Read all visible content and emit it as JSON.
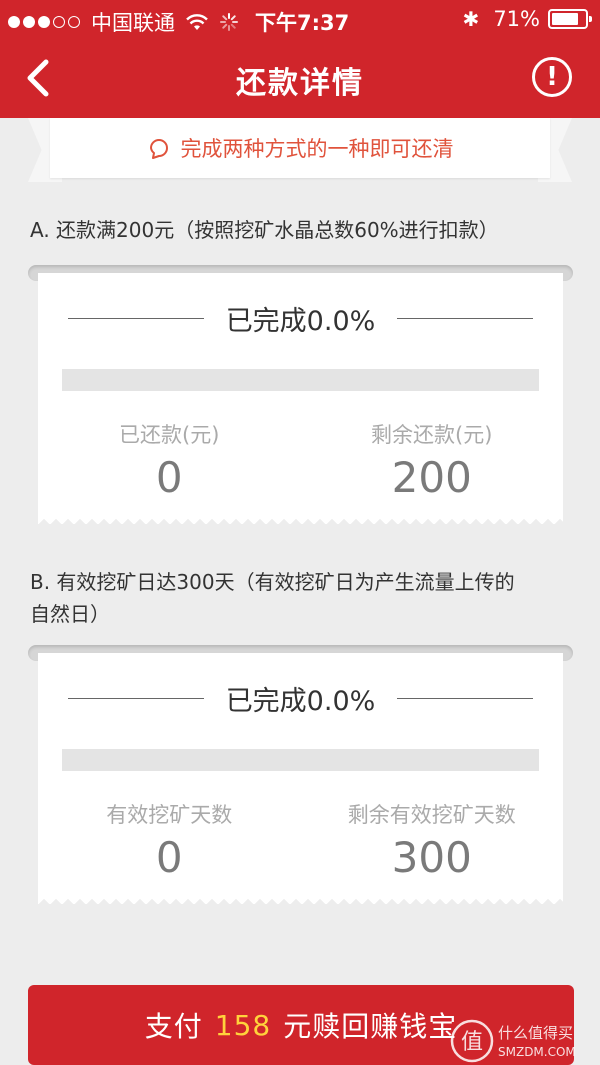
{
  "status_bar": {
    "signal_dots_filled": 3,
    "signal_dots_total": 5,
    "carrier": "中国联通",
    "time": "下午7:37",
    "battery_percent_label": "71%",
    "battery_level": 0.71
  },
  "nav": {
    "title": "还款详情",
    "back_icon": "chevron-left-icon",
    "info_icon": "exclamation-circle-icon",
    "info_glyph": "!"
  },
  "notice": {
    "icon": "bell-icon",
    "text": "完成两种方式的一种即可还清"
  },
  "option_a": {
    "title": "A. 还款满200元（按照挖矿水晶总数60%进行扣款）",
    "progress_label": "已完成0.0%",
    "progress_fraction": 0.0,
    "stat_left_label": "已还款(元)",
    "stat_left_value": "0",
    "stat_right_label": "剩余还款(元)",
    "stat_right_value": "200"
  },
  "option_b": {
    "title_line1": "B. 有效挖矿日达300天（有效挖矿日为产生流量上传的",
    "title_line2": "自然日）",
    "progress_label": "已完成0.0%",
    "progress_fraction": 0.0,
    "stat_left_label": "有效挖矿天数",
    "stat_left_value": "0",
    "stat_right_label": "剩余有效挖矿天数",
    "stat_right_value": "300"
  },
  "pay_button": {
    "prefix": "支付",
    "amount": "158",
    "suffix": "元赎回赚钱宝"
  },
  "watermark": {
    "line1": "什么值得买",
    "line2": "SMZDM.COM",
    "glyph": "值"
  },
  "colors": {
    "brand_red": "#d0252b",
    "notice_text": "#e0533c",
    "amount_yellow": "#ffd23c"
  }
}
